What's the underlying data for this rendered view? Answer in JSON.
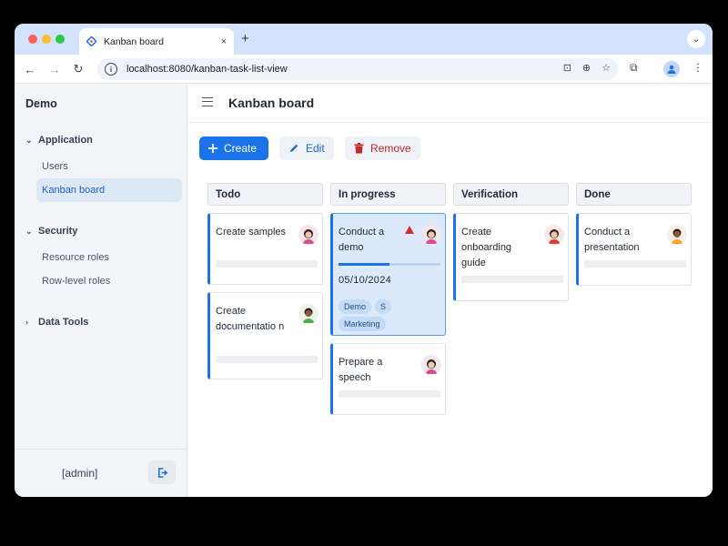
{
  "browser": {
    "tab_title": "Kanban board",
    "tab_close": "×",
    "new_tab": "+",
    "url": "localhost:8080/kanban-task-list-view"
  },
  "sidebar": {
    "brand": "Demo",
    "sections": [
      {
        "label": "Application",
        "expanded": true,
        "items": [
          {
            "label": "Users",
            "active": false
          },
          {
            "label": "Kanban board",
            "active": true
          }
        ]
      },
      {
        "label": "Security",
        "expanded": true,
        "items": [
          {
            "label": "Resource roles",
            "active": false
          },
          {
            "label": "Row-level roles",
            "active": false
          }
        ]
      },
      {
        "label": "Data Tools",
        "expanded": false,
        "items": []
      }
    ],
    "user": "[admin]"
  },
  "header": {
    "title": "Kanban board"
  },
  "actions": {
    "create": "Create",
    "edit": "Edit",
    "remove": "Remove"
  },
  "colors": {
    "accent": "#1a73e8",
    "danger": "#c62828",
    "selected_card": "#dce9fb"
  },
  "columns": [
    {
      "title": "Todo",
      "cards": [
        {
          "title": "Create samples"
        },
        {
          "title": "Create documentatio n"
        }
      ]
    },
    {
      "title": "In progress",
      "cards": [
        {
          "title": "Conduct a demo",
          "priority": "high",
          "progress": 0.5,
          "due": "05/10/2024",
          "tags": [
            "Demo",
            "S",
            "Marketing"
          ],
          "selected": true
        },
        {
          "title": "Prepare a speech"
        }
      ]
    },
    {
      "title": "Verification",
      "cards": [
        {
          "title": "Create onboarding guide"
        }
      ]
    },
    {
      "title": "Done",
      "cards": [
        {
          "title": "Conduct a presentation"
        }
      ]
    }
  ]
}
